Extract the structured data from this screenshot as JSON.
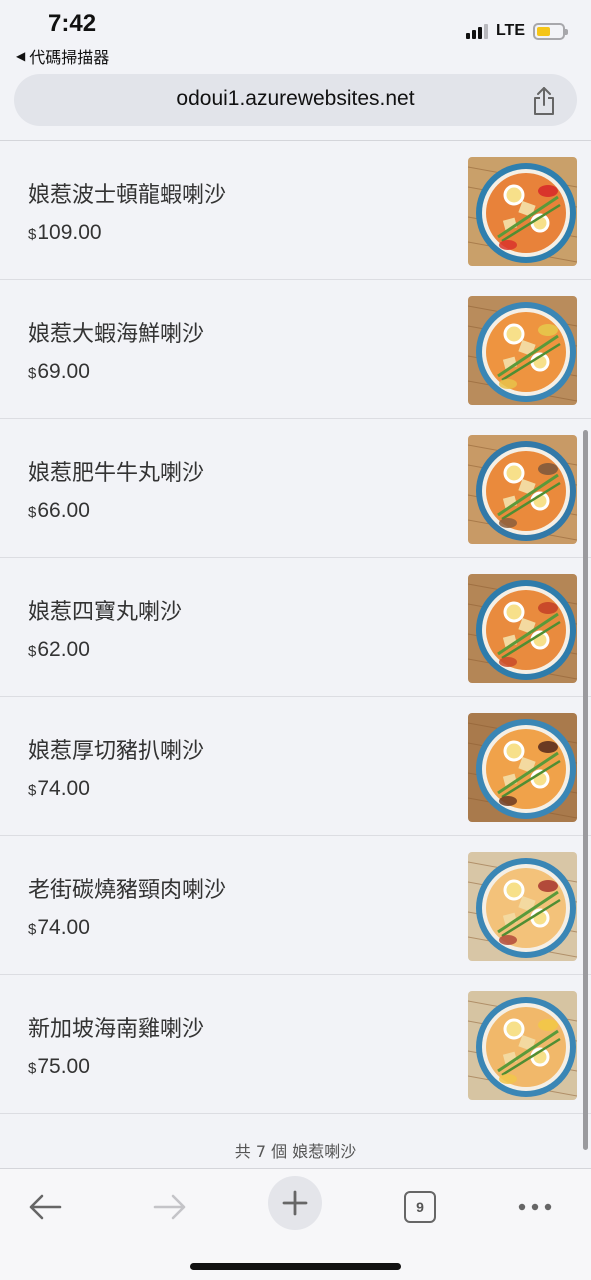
{
  "status_bar": {
    "time": "7:42",
    "back_app": "代碼掃描器",
    "network": "LTE",
    "battery_level": 0.55,
    "signal_bars": 3,
    "signal_bars_max": 4
  },
  "browser": {
    "url": "odoui1.azurewebsites.net",
    "share_icon": "share-icon",
    "tab_count": "9"
  },
  "menu": {
    "currency_symbol": "$",
    "items": [
      {
        "name": "娘惹波士頓龍蝦喇沙",
        "price": "109.00"
      },
      {
        "name": "娘惹大蝦海鮮喇沙",
        "price": "69.00"
      },
      {
        "name": "娘惹肥牛牛丸喇沙",
        "price": "66.00"
      },
      {
        "name": "娘惹四寶丸喇沙",
        "price": "62.00"
      },
      {
        "name": "娘惹厚切豬扒喇沙",
        "price": "74.00"
      },
      {
        "name": "老街碳燒豬頸肉喇沙",
        "price": "74.00"
      },
      {
        "name": "新加坡海南雞喇沙",
        "price": "75.00"
      }
    ],
    "footer": "共 7 個 娘惹喇沙"
  },
  "toolbar": {
    "back_icon": "arrow-left-icon",
    "forward_icon": "arrow-right-icon",
    "new_tab_icon": "plus-icon",
    "more_icon": "ellipsis-icon"
  }
}
